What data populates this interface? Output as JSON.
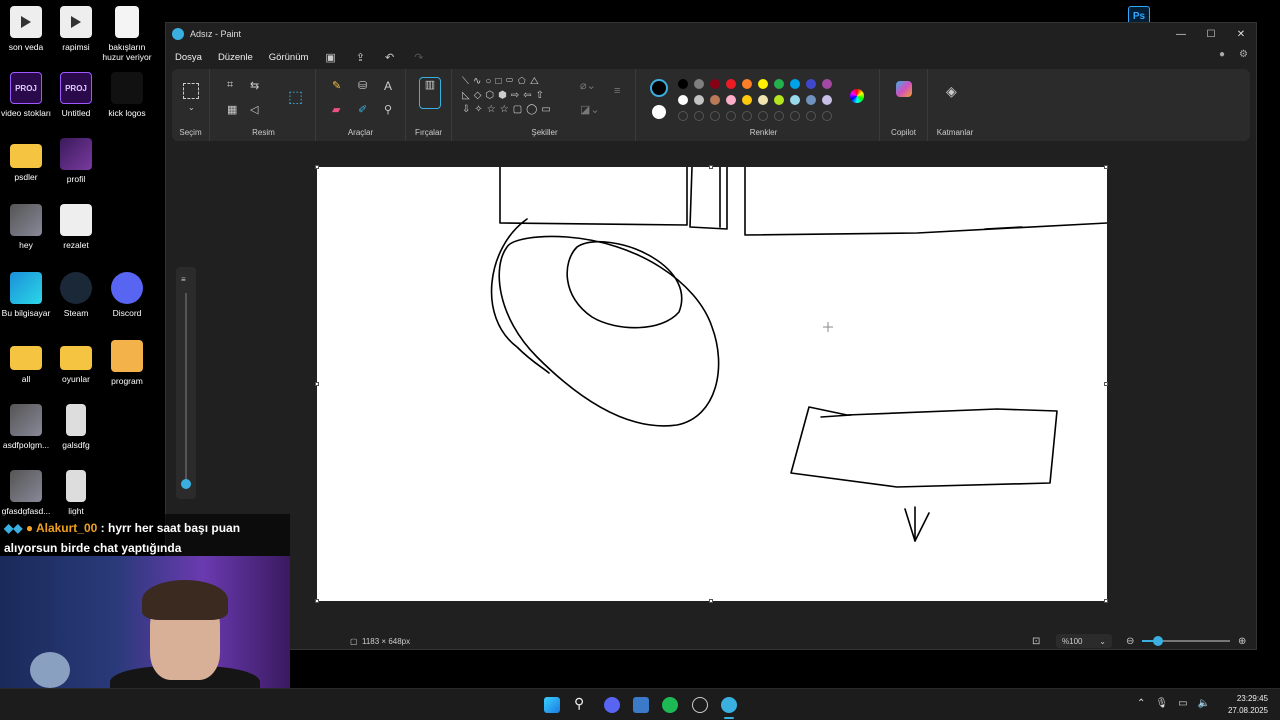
{
  "desktop": {
    "icons": [
      {
        "label": "son veda",
        "type": "video"
      },
      {
        "label": "rapimsi",
        "type": "video"
      },
      {
        "label": "bakışların huzur veriyor",
        "type": "doc"
      },
      {
        "label": "video stokları",
        "type": "proj"
      },
      {
        "label": "Untitled",
        "type": "proj"
      },
      {
        "label": "kick logos",
        "type": "kick"
      },
      {
        "label": "psdler",
        "type": "folder"
      },
      {
        "label": "profil",
        "type": "photo1"
      },
      {
        "label": "hey",
        "type": "photo2"
      },
      {
        "label": "rezalet",
        "type": "green"
      },
      {
        "label": "Bu bilgisayar",
        "type": "pc"
      },
      {
        "label": "Steam",
        "type": "steam"
      },
      {
        "label": "Discord",
        "type": "discord"
      },
      {
        "label": "all",
        "type": "folder"
      },
      {
        "label": "oyunlar",
        "type": "folder"
      },
      {
        "label": "program",
        "type": "prog"
      },
      {
        "label": "asdfpolgm...",
        "type": "photo2"
      },
      {
        "label": "galsdfg",
        "type": "tall"
      },
      {
        "label": "gfasdgfasd...",
        "type": "photo2"
      },
      {
        "label": "light",
        "type": "tall"
      }
    ],
    "proj_badge": "PROJ",
    "ps_badge": "Ps"
  },
  "paint": {
    "title": "Adsız - Paint",
    "menu": [
      "Dosya",
      "Düzenle",
      "Görünüm"
    ],
    "groups": {
      "selection": "Seçim",
      "image": "Resim",
      "tools": "Araçlar",
      "brushes": "Fırçalar",
      "shapes": "Şekiller",
      "colors": "Renkler",
      "copilot": "Copilot",
      "layers": "Katmanlar"
    },
    "palette_row1": [
      "#000000",
      "#7f7f7f",
      "#880015",
      "#ed1c24",
      "#ff7f27",
      "#fff200",
      "#22b14c",
      "#00a2e8",
      "#3f48cc",
      "#a349a4"
    ],
    "palette_row2": [
      "#ffffff",
      "#c3c3c3",
      "#b97a57",
      "#ffaec9",
      "#ffc90e",
      "#efe4b0",
      "#b5e61d",
      "#99d9ea",
      "#7092be",
      "#c8bfe7"
    ],
    "status": {
      "dimensions": "1183 × 648px",
      "zoom": "%100"
    }
  },
  "chat": {
    "user": "Alakurt_00",
    "message": ": hyrr her saat başı puan alıyorsun birde chat yaptığında"
  },
  "taskbar": {
    "time": "23:29:45",
    "date": "27.08.2025"
  }
}
